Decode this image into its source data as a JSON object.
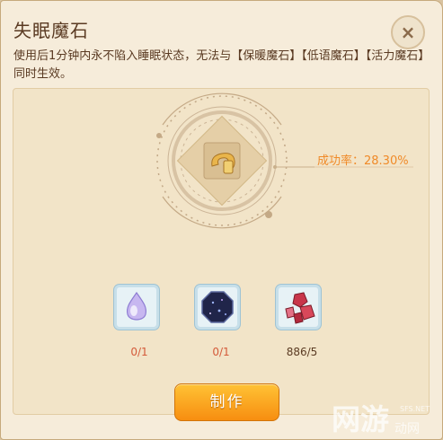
{
  "dialog": {
    "title": "失眠魔石",
    "description": "使用后1分钟内永不陷入睡眠状态，无法与【保暖魔石】【低语魔石】【活力魔石】同时生效。",
    "close_icon": "×",
    "success_rate": "成功率：28.30%"
  },
  "materials": [
    {
      "icon": "water-drop-icon",
      "count": "0/1"
    },
    {
      "icon": "dark-crystal-icon",
      "count": "0/1"
    },
    {
      "icon": "red-ore-icon",
      "count": "886/5"
    }
  ],
  "make_button": "制作",
  "watermark": {
    "brand": "网游",
    "sub": "动网",
    "site": "SFS.NET"
  },
  "colors": {
    "accent": "#f08a28",
    "button": "#f89a18",
    "count_insufficient": "#d45a3a",
    "text": "#5a3a22"
  }
}
